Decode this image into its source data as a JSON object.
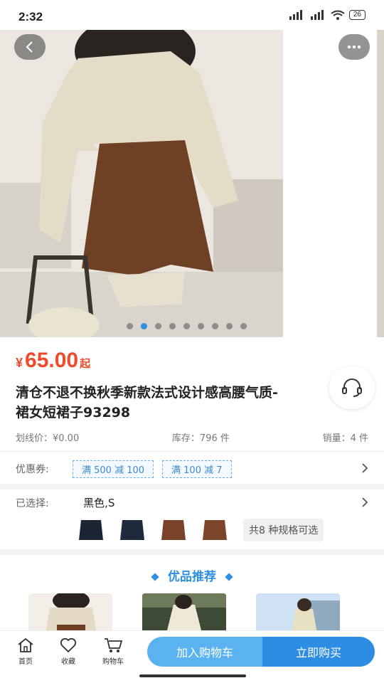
{
  "status": {
    "time": "2:32",
    "battery": "26"
  },
  "gallery": {
    "total_dots": 9,
    "active_index": 1
  },
  "product": {
    "currency": "¥",
    "price": "65.00",
    "price_suffix": "起",
    "title_line1": "清仓不退不换秋季新款法式设计感高腰气质-",
    "title_line2": "裙女短裙子93298",
    "original_price": "划线价：¥0.00",
    "stock": "库存：796 件",
    "sales": "销量：4 件"
  },
  "coupons": {
    "label": "优惠券:",
    "items": [
      "满 500 减 100",
      "满 100 减 7"
    ]
  },
  "selection": {
    "label": "已选择:",
    "value": "黑色,S",
    "spec_badge": "共8 种规格可选",
    "thumb_colors": [
      "#1d2433",
      "#1f2a3c",
      "#7a4228",
      "#7d4529"
    ]
  },
  "recommend": {
    "title": "优品推荐"
  },
  "bottom_nav": {
    "home": "首页",
    "favorite": "收藏",
    "cart": "购物车",
    "add_cart": "加入购物车",
    "buy_now": "立即购买"
  },
  "colors": {
    "accent": "#2d8de2",
    "price": "#f04a2a"
  }
}
